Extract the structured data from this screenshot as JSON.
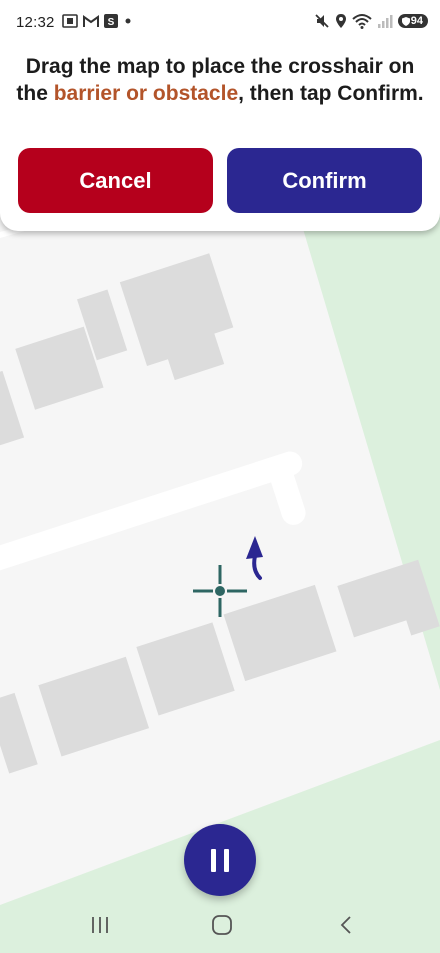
{
  "status_bar": {
    "time": "12:32",
    "left_icons": [
      "screenshot-icon",
      "gmail-icon",
      "s-app-icon",
      "dot-icon"
    ],
    "right_icons": [
      "mute-icon",
      "location-icon",
      "wifi-icon",
      "signal-icon"
    ],
    "battery_level": "94"
  },
  "instruction": {
    "text_before": "Drag the map to place the crosshair on the ",
    "highlight": "barrier or obstacle",
    "text_after": ", then tap Confirm.",
    "highlight_color": "#b3542a"
  },
  "buttons": {
    "cancel_label": "Cancel",
    "confirm_label": "Confirm",
    "cancel_color": "#b5001c",
    "confirm_color": "#2b2791"
  },
  "map": {
    "background_color": "#f6f6f6",
    "park_color": "#dcf0dd",
    "building_color": "#dcdcdc",
    "crosshair_color": "#2e6663",
    "heading_arrow_color": "#2b2791"
  },
  "pause_button": {
    "icon": "pause-icon",
    "color": "#2b2791"
  },
  "nav_bar": {
    "items": [
      "recent-apps-icon",
      "home-icon",
      "back-icon"
    ]
  }
}
